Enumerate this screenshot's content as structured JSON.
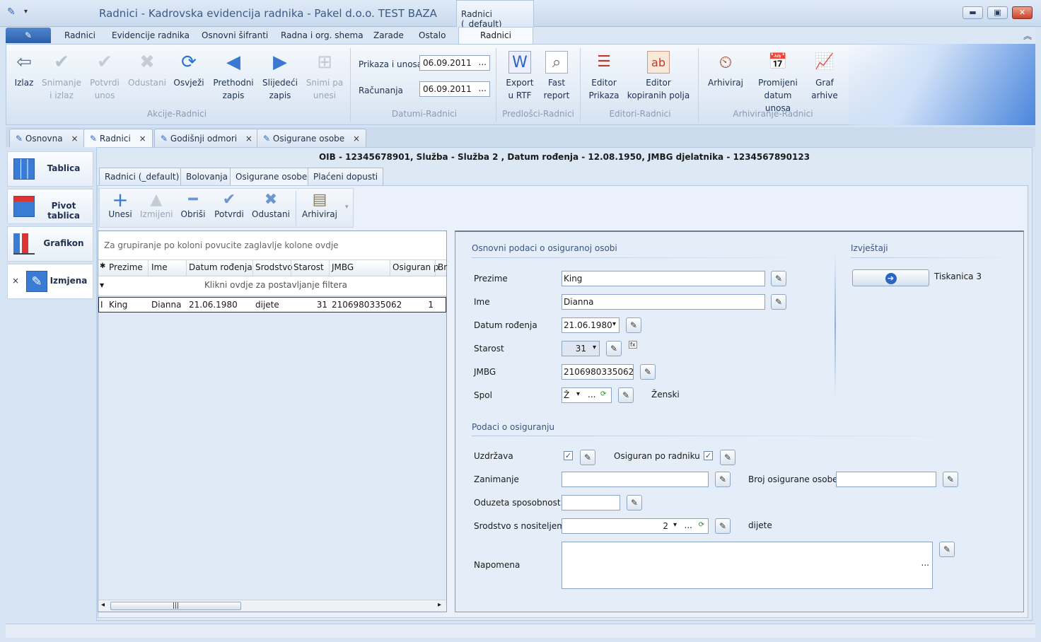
{
  "window": {
    "title": "Radnici - Kadrovska evidencija radnika - Pakel d.o.o. TEST BAZA",
    "context_tab_title": "Radnici (_default)",
    "minimize": "▬",
    "maximize": "▣",
    "close": "✕"
  },
  "menu": {
    "items": [
      "Radnici",
      "Evidencije radnika",
      "Osnovni šifranti",
      "Radna i org. shema",
      "Zarade",
      "Ostalo"
    ],
    "context": "Radnici",
    "collapse": "︽"
  },
  "ribbon": {
    "akcije": {
      "label": "Akcije-Radnici",
      "izlaz": "Izlaz",
      "snimanje_1": "Snimanje",
      "snimanje_2": "i izlaz",
      "potvrdi_1": "Potvrdi",
      "potvrdi_2": "unos",
      "odustani": "Odustani",
      "osvjezi": "Osvježi",
      "prethodni_1": "Prethodni",
      "prethodni_2": "zapis",
      "sljedeci_1": "Slijedeći",
      "sljedeci_2": "zapis",
      "snimi_1": "Snimi pa",
      "snimi_2": "unesi"
    },
    "datumi": {
      "label": "Datumi-Radnici",
      "prikaza_label": "Prikaza i unosa",
      "prikaza_value": "06.09.2011",
      "racunanja_label": "Računanja",
      "racunanja_value": "06.09.2011",
      "dots": "..."
    },
    "predlosci": {
      "label": "Predlošci-Radnici",
      "export_1": "Export",
      "export_2": "u RTF",
      "fast_1": "Fast",
      "fast_2": "report"
    },
    "editori": {
      "label": "Editori-Radnici",
      "editor_prikaza_1": "Editor",
      "editor_prikaza_2": "Prikaza",
      "editor_kop_1": "Editor",
      "editor_kop_2": "kopiranih polja"
    },
    "arhiviranje": {
      "label": "Arhiviranje-Radnici",
      "arhiviraj": "Arhiviraj",
      "promijeni_1": "Promijeni",
      "promijeni_2": "datum unosa",
      "graf_1": "Graf",
      "graf_2": "arhive"
    }
  },
  "doc_tabs": [
    "Osnovna",
    "Radnici",
    "Godišnji odmori",
    "Osigurane osobe"
  ],
  "doc_tab_close": "×",
  "nav": {
    "tablica": "Tablica",
    "pivot": "Pivot tablica",
    "grafikon": "Grafikon",
    "izmjena": "Izmjena",
    "close": "×"
  },
  "info_line": "OIB - 12345678901, Služba - Služba 2 , Datum rođenja - 12.08.1950, JMBG djelatnika - 1234567890123",
  "sub_tabs": [
    "Radnici (_default)",
    "Bolovanja",
    "Osigurane osobe",
    "Plaćeni dopusti"
  ],
  "grid_toolbar": {
    "unesi": "Unesi",
    "izmijeni": "Izmijeni",
    "obrisi": "Obriši",
    "potvrdi": "Potvrdi",
    "odustani": "Odustani",
    "arhiviraj": "Arhiviraj"
  },
  "grid": {
    "group_hint": "Za grupiranje po koloni povucite zaglavlje kolone ovdje",
    "columns": [
      "Prezime",
      "Ime",
      "Datum rođenja",
      "Srodstvo",
      "Starost",
      "JMBG",
      "Osiguran p",
      "Br"
    ],
    "filter_hint": "Klikni ovdje za postavljanje filtera",
    "rows": [
      {
        "prezime": "King",
        "ime": "Dianna",
        "datum": "21.06.1980",
        "srodstvo": "dijete",
        "starost": "31",
        "jmbg": "2106980335062",
        "osiguran": "1"
      }
    ],
    "row_marker": "I",
    "header_marker": "✱",
    "filter_marker": "▼",
    "scroll_left": "◂",
    "scroll_right": "▸",
    "thumb_grip": "|||"
  },
  "form": {
    "section_basic": "Osnovni podaci o osiguranoj osobi",
    "section_reports": "Izvještaji",
    "report_button_label": "Tiskanica 3",
    "report_arrow": "➔",
    "prezime_label": "Prezime",
    "prezime_value": "King",
    "ime_label": "Ime",
    "ime_value": "Dianna",
    "datum_label": "Datum rođenja",
    "datum_value": "21.06.1980",
    "starost_label": "Starost",
    "starost_value": "31",
    "fx": "fx",
    "jmbg_label": "JMBG",
    "jmbg_value": "2106980335062",
    "spol_label": "Spol",
    "spol_value": "Ž",
    "spol_text": "Ženski",
    "section_insurance": "Podaci o osiguranju",
    "uzdrzava_label": "Uzdržava",
    "osiguran_label": "Osiguran po radniku",
    "zanimanje_label": "Zanimanje",
    "zanimanje_value": "",
    "broj_label": "Broj osigurane osobe",
    "broj_value": "",
    "oduzeta_label": "Oduzeta sposobnost",
    "oduzeta_value": "",
    "srodstvo_label": "Srodstvo s nositeljem",
    "srodstvo_value": "2",
    "srodstvo_text": "dijete",
    "napomena_label": "Napomena",
    "napomena_value": "",
    "dots": "...",
    "dropdown": "▾",
    "edit_glyph": "✎",
    "check_glyph": "✓"
  }
}
